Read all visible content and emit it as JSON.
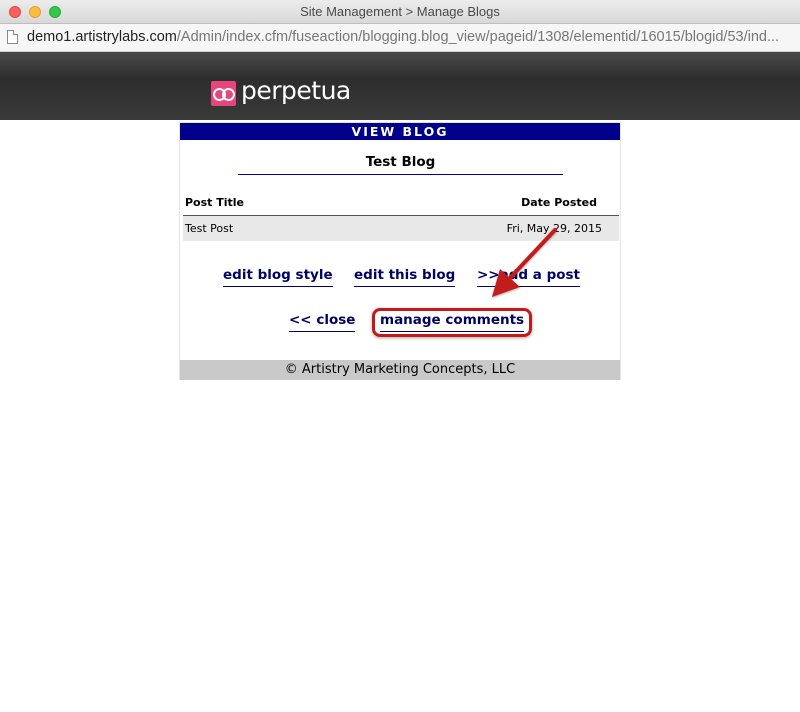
{
  "window": {
    "title": "Site Management > Manage Blogs"
  },
  "address_bar": {
    "host": "demo1.artistrylabs.com",
    "path": "/Admin/index.cfm/fuseaction/blogging.blog_view/pageid/1308/elementid/16015/blogid/53/ind..."
  },
  "site": {
    "logo_text": "perpetua",
    "brand_color": "#e8457c"
  },
  "panel": {
    "header": "VIEW BLOG",
    "header_color": "#00008b",
    "blog_title": "Test Blog",
    "columns": {
      "post_title": "Post Title",
      "date_posted": "Date Posted"
    },
    "posts": [
      {
        "title": "Test Post",
        "date": "Fri, May 29, 2015"
      }
    ],
    "actions": {
      "edit_style": "edit blog style",
      "edit_blog": "edit this blog",
      "add_post": ">>add a post",
      "close": "<< close",
      "manage_comments": "manage comments"
    },
    "footer": "© Artistry Marketing Concepts, LLC"
  },
  "annotation": {
    "color": "#c21a1a"
  }
}
